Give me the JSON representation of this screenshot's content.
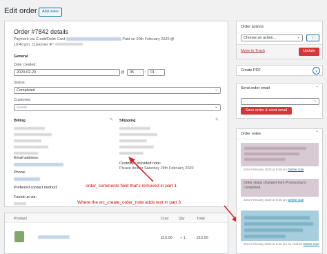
{
  "header": {
    "title": "Edit order",
    "add_order_label": "Add order"
  },
  "order": {
    "title": "Order #7842 details",
    "payment_line_prefix": "Payment via Credit/Debit Card",
    "paid_on": "Paid on 20th February 2020 @",
    "time_ip": "10:40 pm. Customer IP:",
    "general_label": "General",
    "date_created_label": "Date created:",
    "date_value": "2020-02-20",
    "at_symbol": "@",
    "hour_value": "05",
    "minute_value": "01",
    "status_label": "Status:",
    "status_value": "Completed",
    "customer_label": "Customer:",
    "customer_value": "Guest",
    "billing_label": "Billing",
    "shipping_label": "Shipping",
    "email_label": "Email address:",
    "phone_label": "Phone:",
    "preferred_contact_label": "Preferred contact method:",
    "found_us_label": "Found us via:",
    "customer_note_label": "Customer provided note:",
    "customer_note_value": "Please deliver Saturday 29th February 2020"
  },
  "annotations": {
    "note1": "order_comments field that's removed in part 1",
    "note2": "Where the wc_create_order_note adds text in part 3"
  },
  "items": {
    "col_product": "Product",
    "col_cost": "Cost",
    "col_qty": "Qty",
    "col_total": "Total",
    "row_cost": "£16.00",
    "row_qty": "× 1",
    "row_total": "£16.00"
  },
  "sidebar": {
    "order_actions_title": "Order actions",
    "choose_action_placeholder": "Choose an action...",
    "move_to_trash": "Move to Trash",
    "update_label": "Update",
    "create_pdf_title": "Create PDF",
    "send_email_title": "Send order email",
    "save_send_label": "Save order & send email",
    "order_notes_title": "Order notes",
    "notes": [
      {
        "meta": "22nd February 2020 at 9:56 am",
        "delete": "Delete note"
      },
      {
        "text": "Order status changed from Processing to Completed.",
        "meta": "22nd February 2020 at 9:56 am",
        "delete": "Delete note"
      },
      {
        "meta": "22nd February 2020 at 9:56 am by Andrew",
        "delete": "Delete note"
      }
    ]
  },
  "colors": {
    "accent": "#0071a1",
    "danger": "#d63638",
    "annotation": "#e02020",
    "note_private": "#d7cad2",
    "note_customer": "#a7cedc"
  }
}
